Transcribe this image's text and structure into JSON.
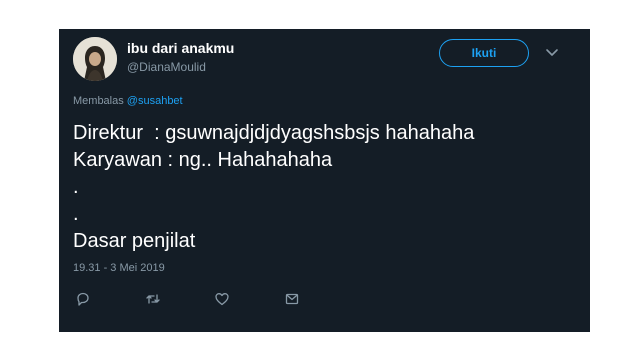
{
  "tweet": {
    "author": {
      "display_name": "ibu dari anakmu",
      "handle": "@DianaMoulid"
    },
    "follow_label": "Ikuti",
    "reply_prefix": "Membalas ",
    "reply_mention": "@susahbet",
    "body_lines": [
      "Direktur  : gsuwnajdjdjdyagshsbsjs hahahaha",
      "Karyawan : ng.. Hahahahaha",
      ".",
      ".",
      "Dasar penjilat"
    ],
    "timestamp": "19.31 - 3 Mei 2019",
    "actions": {
      "reply_icon": "reply-icon",
      "retweet_icon": "retweet-icon",
      "like_icon": "heart-icon",
      "message_icon": "envelope-icon"
    }
  },
  "colors": {
    "background": "#141d26",
    "accent": "#1da1f2",
    "muted": "#8899a6",
    "text": "#ffffff"
  }
}
